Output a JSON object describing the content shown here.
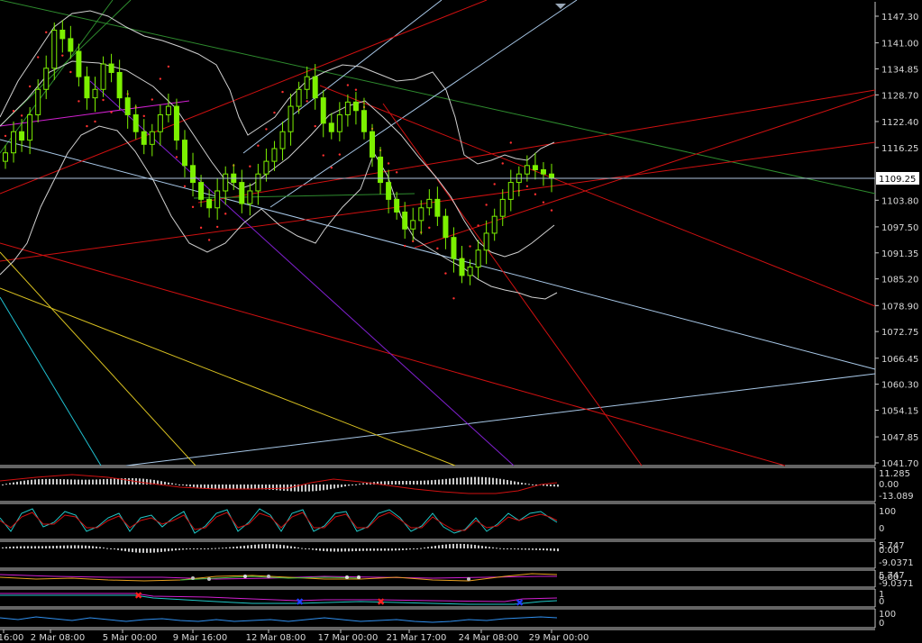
{
  "colors": {
    "background": "#000000",
    "axis": "#c8c8c8",
    "candle_body": "#7cf000",
    "bollinger": "#d0d0d0",
    "sar": "#ff3030",
    "current_price_line": "#b0c4de",
    "label_bg": "#ffffff",
    "label_fg": "#000000"
  },
  "main_price_axis": {
    "ticks": [
      "1147.30",
      "1141.00",
      "1134.85",
      "1128.70",
      "1122.40",
      "1116.25",
      "1103.80",
      "1097.50",
      "1091.35",
      "1085.20",
      "1078.90",
      "1072.75",
      "1066.45",
      "1060.30",
      "1054.15",
      "1047.85",
      "1041.70"
    ],
    "current_price": "1109.25"
  },
  "time_axis": {
    "labels": [
      "16:00",
      "2 Mar 08:00",
      "5 Mar 00:00",
      "9 Mar 16:00",
      "12 Mar 08:00",
      "17 Mar 00:00",
      "21 Mar 17:00",
      "24 Mar 08:00",
      "29 Mar 00:00"
    ]
  },
  "indicator_panels": [
    {
      "name": "macd",
      "ticks": [
        "11.285",
        "0.00",
        "-13.089"
      ]
    },
    {
      "name": "stochastic",
      "ticks": [
        "100",
        "0"
      ]
    },
    {
      "name": "histogram",
      "ticks": [
        "5.747",
        "0.00",
        "-9.0371"
      ]
    },
    {
      "name": "oscillator",
      "ticks": [
        "5.747",
        "0.00",
        "-9.0371"
      ]
    },
    {
      "name": "signal",
      "ticks": [
        "1",
        "0"
      ]
    },
    {
      "name": "rsi",
      "ticks": [
        "100",
        "0"
      ]
    }
  ],
  "chart_data": {
    "type": "candlestick",
    "title": "",
    "ylim": [
      1041.7,
      1147.3
    ],
    "closes": [
      1115,
      1120,
      1118,
      1124,
      1130,
      1135,
      1144,
      1142,
      1139,
      1133,
      1128,
      1130,
      1136,
      1134,
      1128,
      1124,
      1120,
      1117,
      1120,
      1124,
      1126,
      1118,
      1112,
      1108,
      1104,
      1102,
      1106,
      1110,
      1108,
      1103,
      1106,
      1110,
      1113,
      1116,
      1120,
      1126,
      1130,
      1133,
      1128,
      1122,
      1120,
      1124,
      1127,
      1125,
      1120,
      1114,
      1108,
      1104,
      1101,
      1097,
      1099,
      1102,
      1104,
      1100,
      1095,
      1090,
      1086,
      1088,
      1092,
      1096,
      1100,
      1104,
      1108,
      1110,
      1112,
      1111,
      1110,
      1109
    ]
  }
}
